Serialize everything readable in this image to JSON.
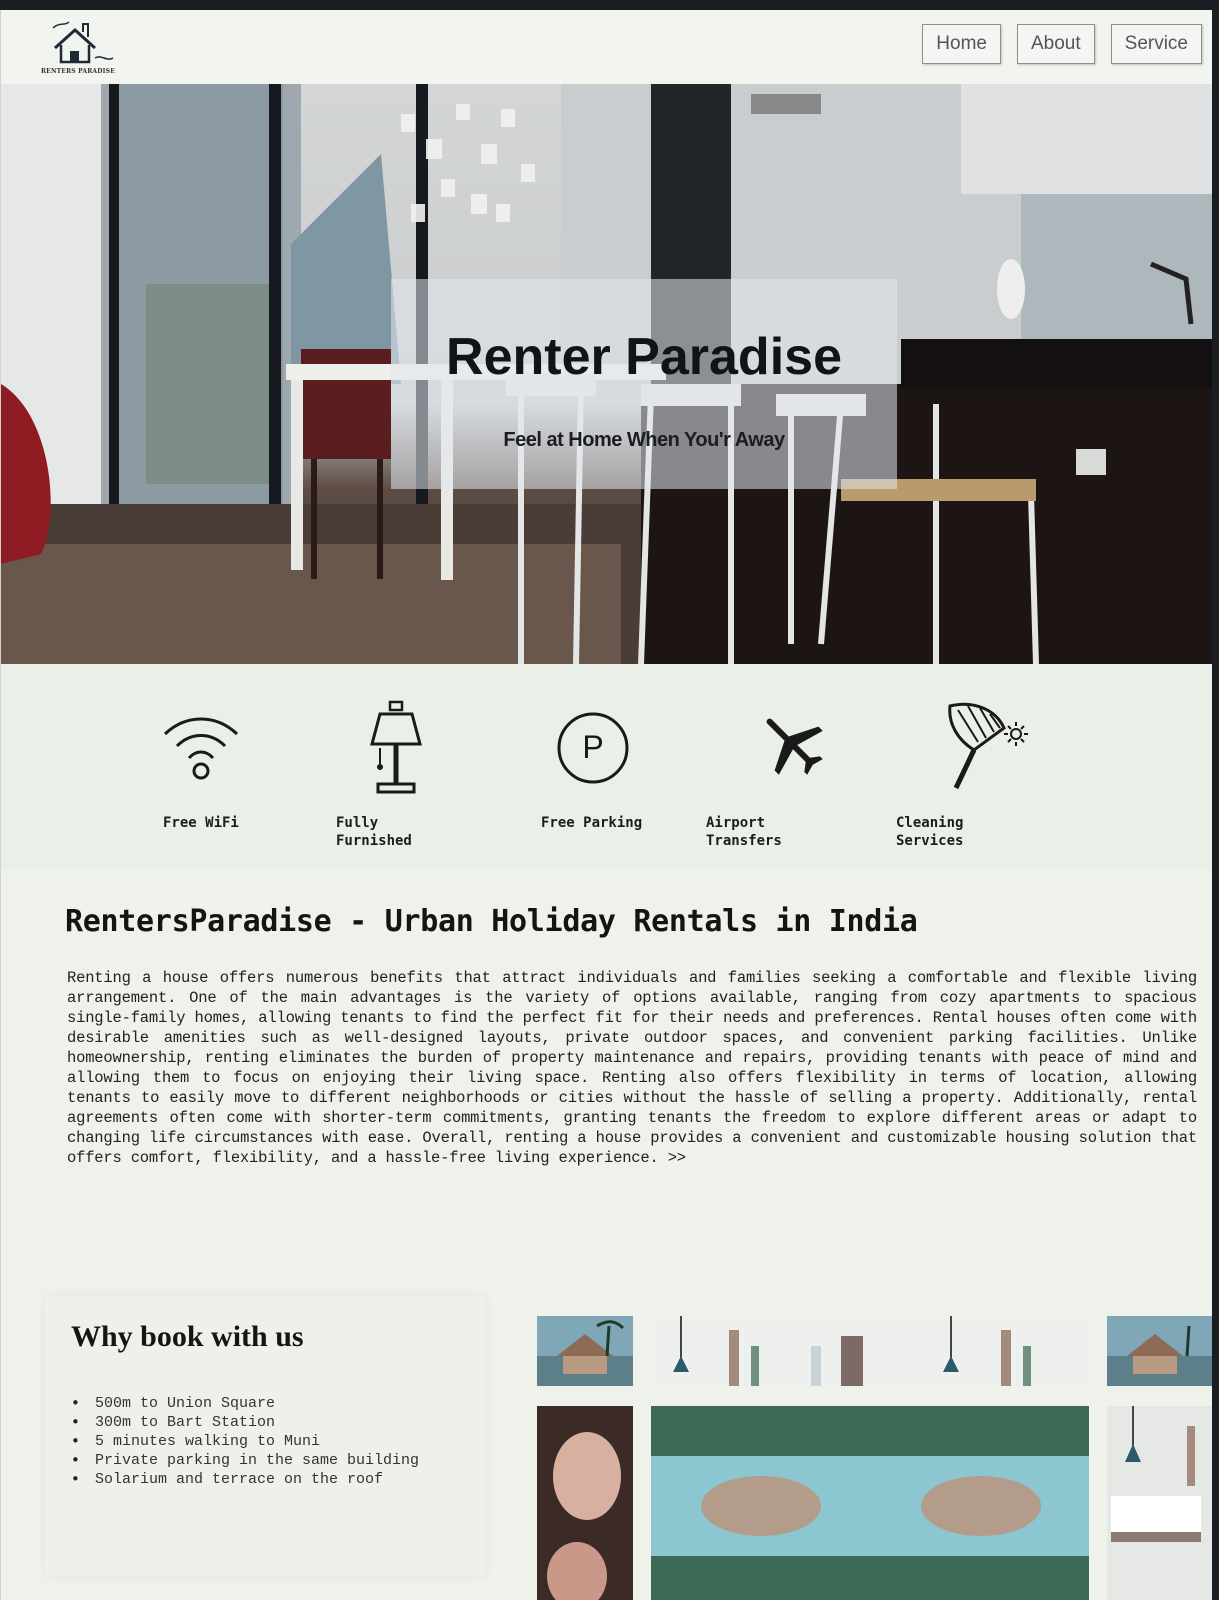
{
  "header": {
    "logo_text": "RENTERS PARADISE",
    "nav": [
      "Home",
      "About",
      "Service"
    ]
  },
  "hero": {
    "title": "Renter Paradise",
    "subtitle": "Feel at Home When You'r Away"
  },
  "amenities": [
    {
      "label": "Free WiFi",
      "icon": "wifi-icon"
    },
    {
      "label": "Fully Furnished",
      "icon": "lamp-icon"
    },
    {
      "label": "Free Parking",
      "icon": "parking-icon"
    },
    {
      "label": "Airport Transfers",
      "icon": "airplane-icon"
    },
    {
      "label": "Cleaning Services",
      "icon": "duster-icon"
    }
  ],
  "intro": {
    "title": "RentersParadise - Urban Holiday Rentals in India",
    "body": "Renting a house offers numerous benefits that attract individuals and families seeking a comfortable and flexible living arrangement. One of the main advantages is the variety of options available, ranging from cozy apartments to spacious single-family homes, allowing tenants to find the perfect fit for their needs and preferences. Rental houses often come with desirable amenities such as well-designed layouts, private outdoor spaces, and convenient parking facilities. Unlike homeownership, renting eliminates the burden of property maintenance and repairs, providing tenants with peace of mind and allowing them to focus on enjoying their living space. Renting also offers flexibility in terms of location, allowing tenants to easily move to different neighborhoods or cities without the hassle of selling a property. Additionally, rental agreements often come with shorter-term commitments, granting tenants the freedom to explore different areas or adapt to changing life circumstances with ease. Overall, renting a house provides a convenient and customizable housing solution that offers comfort, flexibility, and a hassle-free living experience. >>"
  },
  "why": {
    "title": "Why book with us",
    "items": [
      "500m to Union Square",
      "300m to Bart Station",
      "5 minutes walking to Muni",
      "Private parking in the same building",
      "Solarium and terrace on the roof"
    ]
  },
  "colors": {
    "page_bg": "#eef2ea",
    "text_dark": "#141414",
    "hero_overlay": "#e1e8ee"
  }
}
